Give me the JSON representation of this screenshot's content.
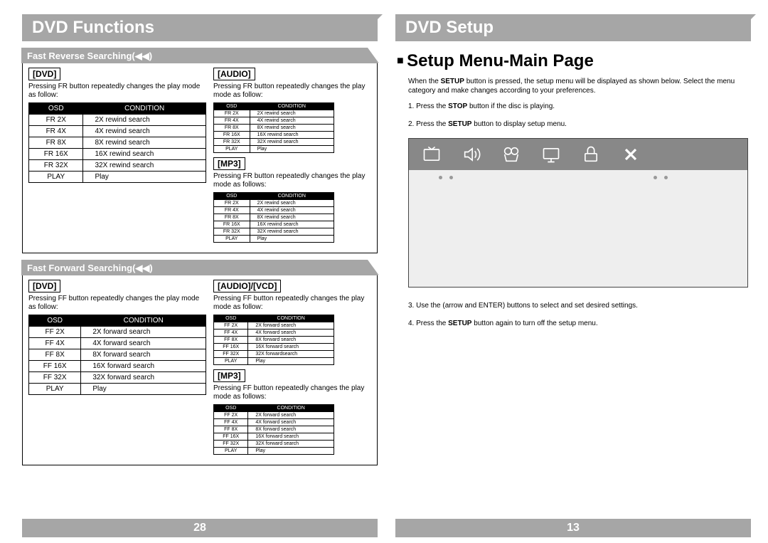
{
  "left": {
    "title": "DVD Functions",
    "page_num": "28",
    "sections": [
      {
        "stripe": "Fast Reverse Searching(◀◀)",
        "main": {
          "label": "[DVD]",
          "desc": "Pressing FR button repeatedly changes the play mode as follow:",
          "table": {
            "headers": [
              "OSD",
              "CONDITION"
            ],
            "rows": [
              [
                "FR 2X",
                "2X rewind search"
              ],
              [
                "FR 4X",
                "4X rewind search"
              ],
              [
                "FR 8X",
                "8X rewind search"
              ],
              [
                "FR 16X",
                "16X rewind search"
              ],
              [
                "FR 32X",
                "32X rewind search"
              ],
              [
                "PLAY",
                "Play"
              ]
            ]
          }
        },
        "side": [
          {
            "label": "[AUDIO]",
            "desc": "Pressing FR button repeatedly changes the play mode as follow:",
            "table": {
              "headers": [
                "OSD",
                "CONDITION"
              ],
              "rows": [
                [
                  "FR 2X",
                  "2X rewind search"
                ],
                [
                  "FR 4X",
                  "4X rewind search"
                ],
                [
                  "FR 8X",
                  "8X rewind search"
                ],
                [
                  "FR 16X",
                  "16X rewind search"
                ],
                [
                  "FR 32X",
                  "32X rewind search"
                ],
                [
                  "PLAY",
                  "Play"
                ]
              ]
            }
          },
          {
            "label": "[MP3]",
            "desc": "Pressing FR button repeatedly changes the play mode as follows:",
            "table": {
              "headers": [
                "OSD",
                "CONDITION"
              ],
              "rows": [
                [
                  "FR 2X",
                  "2X rewind search"
                ],
                [
                  "FR 4X",
                  "4X rewind search"
                ],
                [
                  "FR 8X",
                  "8X rewind search"
                ],
                [
                  "FR 16X",
                  "16X rewind search"
                ],
                [
                  "FR 32X",
                  "32X rewind search"
                ],
                [
                  "PLAY",
                  "Play"
                ]
              ]
            }
          }
        ]
      },
      {
        "stripe": "Fast Forward Searching(◀◀)",
        "main": {
          "label": "[DVD]",
          "desc": "Pressing FF button repeatedly changes the play mode as follow:",
          "table": {
            "headers": [
              "OSD",
              "CONDITION"
            ],
            "rows": [
              [
                "FF 2X",
                "2X forward search"
              ],
              [
                "FF 4X",
                "4X forward search"
              ],
              [
                "FF 8X",
                "8X forward search"
              ],
              [
                "FF 16X",
                "16X forward search"
              ],
              [
                "FF 32X",
                "32X forward search"
              ],
              [
                "PLAY",
                "Play"
              ]
            ]
          }
        },
        "side": [
          {
            "label": "[AUDIO]/[VCD]",
            "desc": "Pressing FF button repeatedly changes the play mode as follow:",
            "table": {
              "headers": [
                "OSD",
                "CONDITION"
              ],
              "rows": [
                [
                  "FF 2X",
                  "2X forward search"
                ],
                [
                  "FF 4X",
                  "4X forward search"
                ],
                [
                  "FF 8X",
                  "8X forward search"
                ],
                [
                  "FF 16X",
                  "16X forward search"
                ],
                [
                  "FF 32X",
                  "32X forwardsearch"
                ],
                [
                  "PLAY",
                  "Play"
                ]
              ]
            }
          },
          {
            "label": "[MP3]",
            "desc": "Pressing FF button repeatedly changes the play mode as follows:",
            "table": {
              "headers": [
                "OSD",
                "CONDITION"
              ],
              "rows": [
                [
                  "FF 2X",
                  "2X forward search"
                ],
                [
                  "FF 4X",
                  "4X forward search"
                ],
                [
                  "FF 8X",
                  "8X forward search"
                ],
                [
                  "FF 16X",
                  "16X forward search"
                ],
                [
                  "FF 32X",
                  "32X forward search"
                ],
                [
                  "PLAY",
                  "Play"
                ]
              ]
            }
          }
        ]
      }
    ]
  },
  "right": {
    "title": "DVD Setup",
    "page_num": "13",
    "heading": "Setup Menu-Main Page",
    "intro_a": "When the ",
    "intro_b": "SETUP",
    "intro_c": " button is pressed, the setup menu will be displayed as shown below. Select the menu category and make changes according to your preferences.",
    "step1_a": "1. Press the ",
    "step1_b": "STOP",
    "step1_c": " button if the disc is playing.",
    "step2_a": "2. Press the ",
    "step2_b": "SETUP",
    "step2_c": " button to display setup menu.",
    "step3": "3. Use the (arrow and ENTER) buttons to select and set desired settings.",
    "step4_a": "4. Press the ",
    "step4_b": "SETUP",
    "step4_c": " button again to turn off the setup menu."
  }
}
